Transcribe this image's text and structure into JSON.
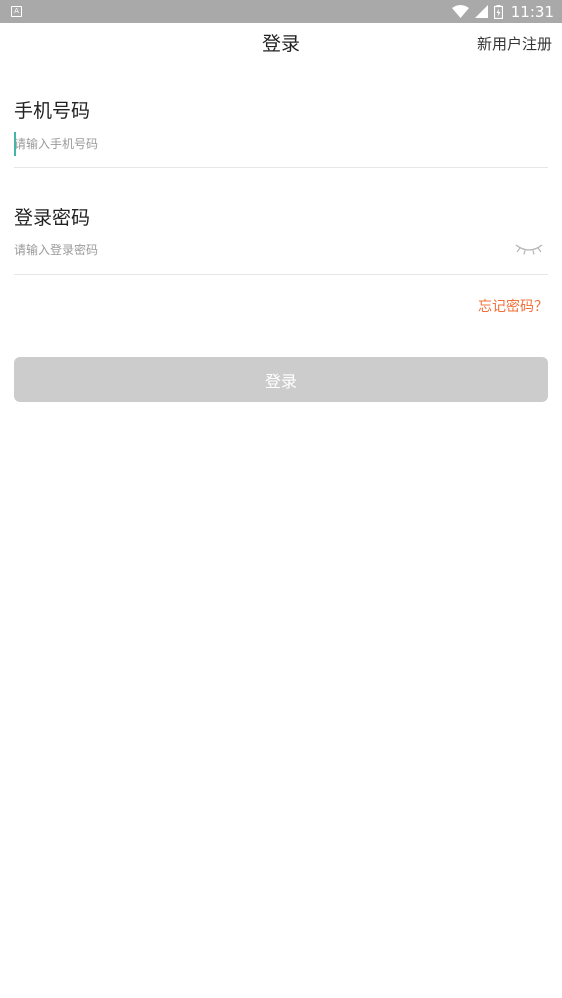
{
  "status_bar": {
    "left_icon": "A",
    "time": "11:31",
    "icons": [
      "wifi-icon",
      "signal-icon",
      "battery-icon"
    ]
  },
  "header": {
    "title": "登录",
    "register_label": "新用户注册"
  },
  "phone": {
    "label": "手机号码",
    "placeholder": "请输入手机号码",
    "value": ""
  },
  "password": {
    "label": "登录密码",
    "placeholder": "请输入登录密码",
    "value": "",
    "toggle_icon": "eye-closed-icon"
  },
  "forgot_label": "忘记密码？",
  "login_label": "登录",
  "colors": {
    "status_bar": "#a9a9a9",
    "accent_link": "#f0703a",
    "button_disabled": "#cccccc",
    "caret": "#3fb6a8"
  }
}
